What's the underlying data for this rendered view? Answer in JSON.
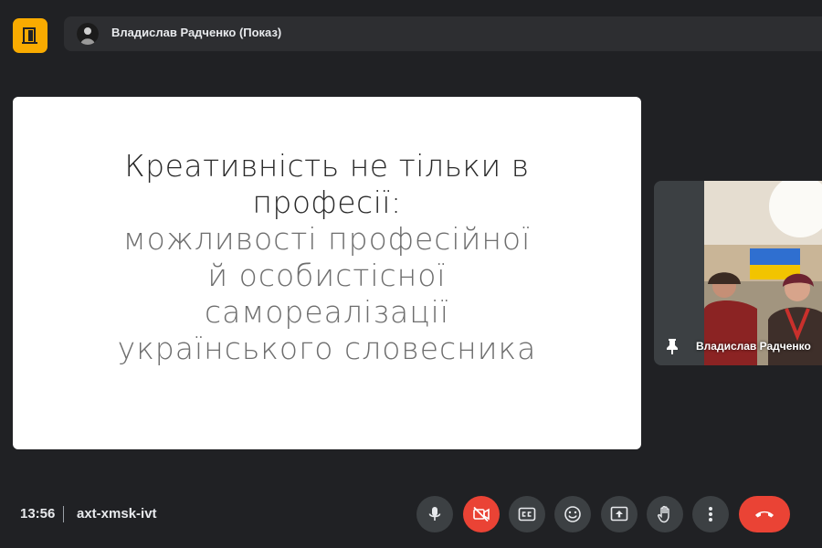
{
  "header": {
    "presenter_label": "Владислав Радченко (Показ)"
  },
  "slide": {
    "lines": [
      "Креативність не тільки в",
      "професії:",
      "можливості професійної",
      "й особистісної",
      "самореалізації",
      "українського словесника"
    ]
  },
  "participant": {
    "name": "Владислав Радченко"
  },
  "footer": {
    "time": "13:56",
    "meeting_code": "axt-xmsk-ivt"
  },
  "controls": [
    {
      "name": "microphone",
      "icon": "mic-icon"
    },
    {
      "name": "camera",
      "icon": "camera-off-icon",
      "state": "off"
    },
    {
      "name": "captions",
      "icon": "cc-icon"
    },
    {
      "name": "reactions",
      "icon": "emoji-icon"
    },
    {
      "name": "present",
      "icon": "present-icon"
    },
    {
      "name": "raise-hand",
      "icon": "hand-icon"
    },
    {
      "name": "more-options",
      "icon": "more-vert-icon"
    },
    {
      "name": "leave-call",
      "icon": "hang-up-icon"
    }
  ],
  "colors": {
    "background": "#202124",
    "accent_badge": "#f9ab00",
    "danger": "#ea4335",
    "control": "#3c4043"
  }
}
